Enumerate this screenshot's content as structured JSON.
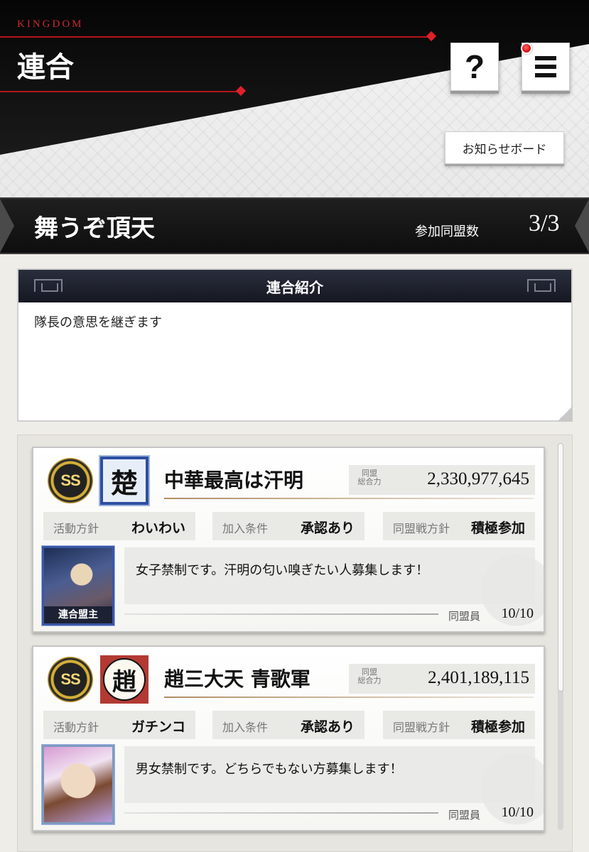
{
  "header": {
    "brand": "KINGDOM",
    "title": "連合",
    "notice_button": "お知らせボード"
  },
  "union": {
    "name": "舞うぞ頂天",
    "member_count_label": "参加同盟数",
    "member_count_value": "3/3"
  },
  "intro": {
    "heading": "連合紹介",
    "text": "隊長の意思を継ぎます"
  },
  "alliances": [
    {
      "rank": "SS",
      "emblem": "楚",
      "name": "中華最高は汗明",
      "power_label": "同盟\n総合力",
      "power": "2,330,977,645",
      "tags": [
        {
          "key": "活動方針",
          "value": "わいわい"
        },
        {
          "key": "加入条件",
          "value": "承認あり"
        },
        {
          "key": "同盟戦方針",
          "value": "積極参加"
        }
      ],
      "leader_badge": "連合盟主",
      "comment": "女子禁制です。汗明の匂い嗅ぎたい人募集します！",
      "members_label": "同盟員",
      "members": "10/10"
    },
    {
      "rank": "SS",
      "emblem": "趙",
      "name": "趙三大天 青歌軍",
      "power_label": "同盟\n総合力",
      "power": "2,401,189,115",
      "tags": [
        {
          "key": "活動方針",
          "value": "ガチンコ"
        },
        {
          "key": "加入条件",
          "value": "承認あり"
        },
        {
          "key": "同盟戦方針",
          "value": "積極参加"
        }
      ],
      "comment": "男女禁制です。どちらでもない方募集します！",
      "members_label": "同盟員",
      "members": "10/10"
    }
  ],
  "colors": {
    "accent_red": "#c7282c",
    "header_dark": "#111111",
    "intro_head": "#1f2330",
    "emblem_blue": "#2d4fa1",
    "emblem_red": "#b23a33"
  },
  "icons": {
    "help": "question-mark-icon",
    "menu": "hamburger-menu-icon"
  }
}
